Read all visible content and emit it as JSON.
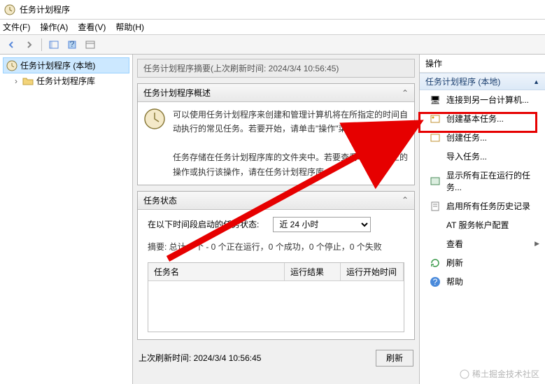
{
  "window": {
    "title": "任务计划程序"
  },
  "menu": {
    "file": "文件(F)",
    "action": "操作(A)",
    "view": "查看(V)",
    "help": "帮助(H)"
  },
  "tree": {
    "root": "任务计划程序 (本地)",
    "library": "任务计划程序库"
  },
  "summary": {
    "title": "任务计划程序摘要(上次刷新时间: 2024/3/4 10:56:45)"
  },
  "overview": {
    "title": "任务计划程序概述",
    "body": "可以使用任务计划程序来创建和管理计算机将在所指定的时间自动执行的常见任务。若要开始，请单击\"操作\"菜单中的命令。\n\n任务存储在任务计划程序库的文件夹中。若要查看单独任务上的操作或执行该操作，请在任务计划程序库"
  },
  "status": {
    "title": "任务状态",
    "range_label": "在以下时间段启动的任务状态:",
    "range_value": "近 24 小时",
    "summary": "摘要: 总计 0 个 - 0 个正在运行，0 个成功，0 个停止，0 个失败",
    "columns": {
      "name": "任务名",
      "result": "运行结果",
      "start": "运行开始时间"
    }
  },
  "bottom": {
    "last_refresh": "上次刷新时间: 2024/3/4 10:56:45",
    "refresh": "刷新"
  },
  "actions": {
    "title": "操作",
    "group": "任务计划程序 (本地)",
    "items": {
      "connect": "连接到另一台计算机...",
      "create_basic": "创建基本任务...",
      "create": "创建任务...",
      "import": "导入任务...",
      "show_running": "显示所有正在运行的任务...",
      "enable_history": "启用所有任务历史记录",
      "at_service": "AT 服务帐户配置",
      "view": "查看",
      "refresh": "刷新",
      "help": "帮助"
    }
  },
  "watermark": "稀土掘金技术社区"
}
